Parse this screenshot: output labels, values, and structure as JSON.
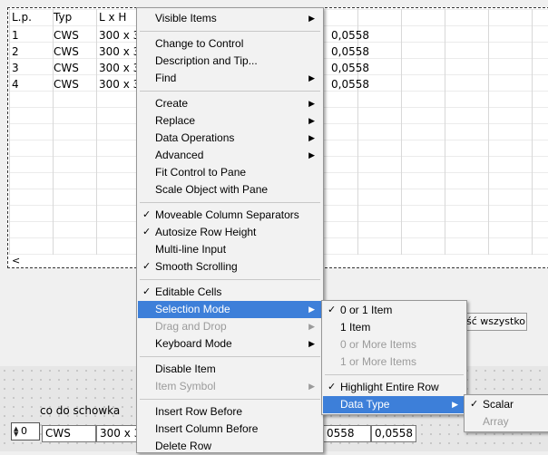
{
  "table": {
    "headers": [
      "L.p.",
      "Typ",
      "L x H"
    ],
    "rows": [
      {
        "lp": "1",
        "typ": "CWS",
        "lxh": "300 x 300",
        "val": "0,0558"
      },
      {
        "lp": "2",
        "typ": "CWS",
        "lxh": "300 x 300",
        "val": "0,0558"
      },
      {
        "lp": "3",
        "typ": "CWS",
        "lxh": "300 x 300",
        "val": "0,0558"
      },
      {
        "lp": "4",
        "typ": "CWS",
        "lxh": "300 x 300",
        "val": "0,0558"
      }
    ],
    "scroll_left": "<"
  },
  "select_all_label": "ść wszystko",
  "copy_label": "co do schowka",
  "bottom": {
    "index": "0",
    "cells": [
      "CWS",
      "300 x 300",
      "0558",
      "0,0558"
    ]
  },
  "menu_main": [
    {
      "label": "Visible Items",
      "submenu": true
    },
    {
      "sep": true
    },
    {
      "label": "Change to Control"
    },
    {
      "label": "Description and Tip..."
    },
    {
      "label": "Find",
      "submenu": true
    },
    {
      "sep": true
    },
    {
      "label": "Create",
      "submenu": true
    },
    {
      "label": "Replace",
      "submenu": true
    },
    {
      "label": "Data Operations",
      "submenu": true
    },
    {
      "label": "Advanced",
      "submenu": true
    },
    {
      "label": "Fit Control to Pane"
    },
    {
      "label": "Scale Object with Pane"
    },
    {
      "sep": true
    },
    {
      "label": "Moveable Column Separators",
      "checked": true
    },
    {
      "label": "Autosize Row Height",
      "checked": true
    },
    {
      "label": "Multi-line Input"
    },
    {
      "label": "Smooth Scrolling",
      "checked": true
    },
    {
      "sep": true
    },
    {
      "label": "Editable Cells",
      "checked": true
    },
    {
      "label": "Selection Mode",
      "submenu": true,
      "highlighted": true
    },
    {
      "label": "Drag and Drop",
      "submenu": true,
      "disabled": true
    },
    {
      "label": "Keyboard Mode",
      "submenu": true
    },
    {
      "sep": true
    },
    {
      "label": "Disable Item"
    },
    {
      "label": "Item Symbol",
      "submenu": true,
      "disabled": true
    },
    {
      "sep": true
    },
    {
      "label": "Insert Row Before"
    },
    {
      "label": "Insert Column Before"
    },
    {
      "label": "Delete Row"
    }
  ],
  "menu_selection": [
    {
      "label": "0 or 1 Item",
      "checked": true
    },
    {
      "label": "1 Item"
    },
    {
      "label": "0 or More Items",
      "disabled": true
    },
    {
      "label": "1 or More Items",
      "disabled": true
    },
    {
      "sep": true
    },
    {
      "label": "Highlight Entire Row",
      "checked": true
    },
    {
      "label": "Data Type",
      "submenu": true,
      "highlighted": true
    }
  ],
  "menu_datatype": [
    {
      "label": "Scalar",
      "checked": true
    },
    {
      "label": "Array",
      "disabled": true
    }
  ],
  "glyphs": {
    "check": "✓",
    "arrow": "▶"
  }
}
